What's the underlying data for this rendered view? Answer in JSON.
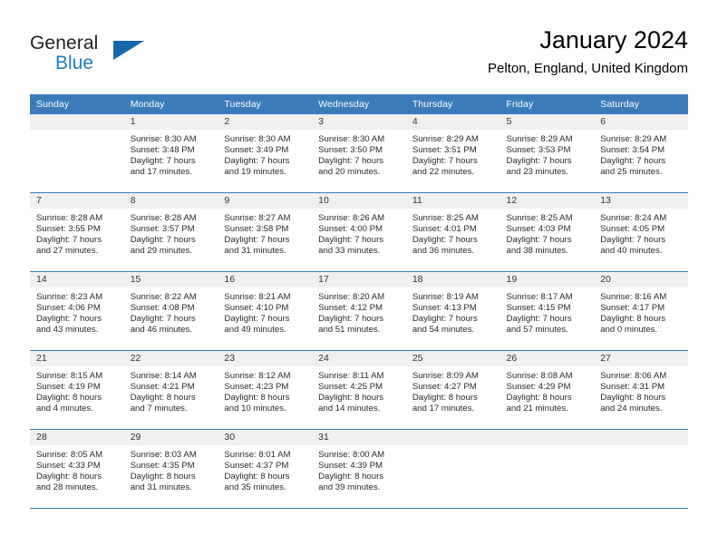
{
  "brand": {
    "word1": "General",
    "word2": "Blue",
    "accent_color": "#1668ad",
    "text_color": "#231f20",
    "blue_text_color": "#1f7dc4",
    "triangle_icon": "triangle-icon"
  },
  "header": {
    "title": "January 2024",
    "subtitle": "Pelton, England, United Kingdom"
  },
  "theme": {
    "header_bg": "#3b7cb8",
    "header_text": "#ffffff",
    "daynum_bg": "#f0f0f0",
    "row_border": "#3b7cb8",
    "body_text": "#2a2a2a"
  },
  "weekday_headers": [
    "Sunday",
    "Monday",
    "Tuesday",
    "Wednesday",
    "Thursday",
    "Friday",
    "Saturday"
  ],
  "weeks": [
    [
      {
        "day": "",
        "lines": []
      },
      {
        "day": "1",
        "lines": [
          "Sunrise: 8:30 AM",
          "Sunset: 3:48 PM",
          "Daylight: 7 hours",
          "and 17 minutes."
        ]
      },
      {
        "day": "2",
        "lines": [
          "Sunrise: 8:30 AM",
          "Sunset: 3:49 PM",
          "Daylight: 7 hours",
          "and 19 minutes."
        ]
      },
      {
        "day": "3",
        "lines": [
          "Sunrise: 8:30 AM",
          "Sunset: 3:50 PM",
          "Daylight: 7 hours",
          "and 20 minutes."
        ]
      },
      {
        "day": "4",
        "lines": [
          "Sunrise: 8:29 AM",
          "Sunset: 3:51 PM",
          "Daylight: 7 hours",
          "and 22 minutes."
        ]
      },
      {
        "day": "5",
        "lines": [
          "Sunrise: 8:29 AM",
          "Sunset: 3:53 PM",
          "Daylight: 7 hours",
          "and 23 minutes."
        ]
      },
      {
        "day": "6",
        "lines": [
          "Sunrise: 8:29 AM",
          "Sunset: 3:54 PM",
          "Daylight: 7 hours",
          "and 25 minutes."
        ]
      }
    ],
    [
      {
        "day": "7",
        "lines": [
          "Sunrise: 8:28 AM",
          "Sunset: 3:55 PM",
          "Daylight: 7 hours",
          "and 27 minutes."
        ]
      },
      {
        "day": "8",
        "lines": [
          "Sunrise: 8:28 AM",
          "Sunset: 3:57 PM",
          "Daylight: 7 hours",
          "and 29 minutes."
        ]
      },
      {
        "day": "9",
        "lines": [
          "Sunrise: 8:27 AM",
          "Sunset: 3:58 PM",
          "Daylight: 7 hours",
          "and 31 minutes."
        ]
      },
      {
        "day": "10",
        "lines": [
          "Sunrise: 8:26 AM",
          "Sunset: 4:00 PM",
          "Daylight: 7 hours",
          "and 33 minutes."
        ]
      },
      {
        "day": "11",
        "lines": [
          "Sunrise: 8:25 AM",
          "Sunset: 4:01 PM",
          "Daylight: 7 hours",
          "and 36 minutes."
        ]
      },
      {
        "day": "12",
        "lines": [
          "Sunrise: 8:25 AM",
          "Sunset: 4:03 PM",
          "Daylight: 7 hours",
          "and 38 minutes."
        ]
      },
      {
        "day": "13",
        "lines": [
          "Sunrise: 8:24 AM",
          "Sunset: 4:05 PM",
          "Daylight: 7 hours",
          "and 40 minutes."
        ]
      }
    ],
    [
      {
        "day": "14",
        "lines": [
          "Sunrise: 8:23 AM",
          "Sunset: 4:06 PM",
          "Daylight: 7 hours",
          "and 43 minutes."
        ]
      },
      {
        "day": "15",
        "lines": [
          "Sunrise: 8:22 AM",
          "Sunset: 4:08 PM",
          "Daylight: 7 hours",
          "and 46 minutes."
        ]
      },
      {
        "day": "16",
        "lines": [
          "Sunrise: 8:21 AM",
          "Sunset: 4:10 PM",
          "Daylight: 7 hours",
          "and 49 minutes."
        ]
      },
      {
        "day": "17",
        "lines": [
          "Sunrise: 8:20 AM",
          "Sunset: 4:12 PM",
          "Daylight: 7 hours",
          "and 51 minutes."
        ]
      },
      {
        "day": "18",
        "lines": [
          "Sunrise: 8:19 AM",
          "Sunset: 4:13 PM",
          "Daylight: 7 hours",
          "and 54 minutes."
        ]
      },
      {
        "day": "19",
        "lines": [
          "Sunrise: 8:17 AM",
          "Sunset: 4:15 PM",
          "Daylight: 7 hours",
          "and 57 minutes."
        ]
      },
      {
        "day": "20",
        "lines": [
          "Sunrise: 8:16 AM",
          "Sunset: 4:17 PM",
          "Daylight: 8 hours",
          "and 0 minutes."
        ]
      }
    ],
    [
      {
        "day": "21",
        "lines": [
          "Sunrise: 8:15 AM",
          "Sunset: 4:19 PM",
          "Daylight: 8 hours",
          "and 4 minutes."
        ]
      },
      {
        "day": "22",
        "lines": [
          "Sunrise: 8:14 AM",
          "Sunset: 4:21 PM",
          "Daylight: 8 hours",
          "and 7 minutes."
        ]
      },
      {
        "day": "23",
        "lines": [
          "Sunrise: 8:12 AM",
          "Sunset: 4:23 PM",
          "Daylight: 8 hours",
          "and 10 minutes."
        ]
      },
      {
        "day": "24",
        "lines": [
          "Sunrise: 8:11 AM",
          "Sunset: 4:25 PM",
          "Daylight: 8 hours",
          "and 14 minutes."
        ]
      },
      {
        "day": "25",
        "lines": [
          "Sunrise: 8:09 AM",
          "Sunset: 4:27 PM",
          "Daylight: 8 hours",
          "and 17 minutes."
        ]
      },
      {
        "day": "26",
        "lines": [
          "Sunrise: 8:08 AM",
          "Sunset: 4:29 PM",
          "Daylight: 8 hours",
          "and 21 minutes."
        ]
      },
      {
        "day": "27",
        "lines": [
          "Sunrise: 8:06 AM",
          "Sunset: 4:31 PM",
          "Daylight: 8 hours",
          "and 24 minutes."
        ]
      }
    ],
    [
      {
        "day": "28",
        "lines": [
          "Sunrise: 8:05 AM",
          "Sunset: 4:33 PM",
          "Daylight: 8 hours",
          "and 28 minutes."
        ]
      },
      {
        "day": "29",
        "lines": [
          "Sunrise: 8:03 AM",
          "Sunset: 4:35 PM",
          "Daylight: 8 hours",
          "and 31 minutes."
        ]
      },
      {
        "day": "30",
        "lines": [
          "Sunrise: 8:01 AM",
          "Sunset: 4:37 PM",
          "Daylight: 8 hours",
          "and 35 minutes."
        ]
      },
      {
        "day": "31",
        "lines": [
          "Sunrise: 8:00 AM",
          "Sunset: 4:39 PM",
          "Daylight: 8 hours",
          "and 39 minutes."
        ]
      },
      {
        "day": "",
        "lines": []
      },
      {
        "day": "",
        "lines": []
      },
      {
        "day": "",
        "lines": []
      }
    ]
  ]
}
